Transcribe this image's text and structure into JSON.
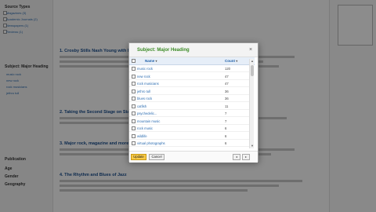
{
  "modal": {
    "title": "Subject: Major Heading",
    "close_icon": "×",
    "columns": {
      "name": "Name",
      "count": "Count"
    },
    "rows": [
      {
        "name": "music rock",
        "count": "120"
      },
      {
        "name": "new rock",
        "count": "47"
      },
      {
        "name": "rock musicians",
        "count": "47"
      },
      {
        "name": "jethro tull",
        "count": "36"
      },
      {
        "name": "blues rock",
        "count": "36"
      },
      {
        "name": "catfish",
        "count": "11"
      },
      {
        "name": "psychedelic...",
        "count": "7"
      },
      {
        "name": "mountain music",
        "count": "7"
      },
      {
        "name": "rock music",
        "count": "6"
      },
      {
        "name": "wildlife",
        "count": "6"
      },
      {
        "name": "virtual photographs",
        "count": "6"
      }
    ],
    "buttons": {
      "update": "Update",
      "cancel": "Cancel"
    },
    "pager": {
      "prev": "◂",
      "next": "▸"
    }
  },
  "background": {
    "sidebar": {
      "heading_1": "Source Types",
      "items_1": [
        "Magazines (3)",
        "Academic Journals (2)",
        "Newspapers (1)",
        "Reviews (1)"
      ],
      "heading_2": "Subject: Major Heading",
      "items_2": [
        "music rock",
        "new rock",
        "rock musicians",
        "jethro tull"
      ],
      "heading_3": "Publication",
      "heading_4": "Age",
      "heading_5": "Gender",
      "heading_6": "Geography"
    },
    "results": [
      "1. Crosby Stills Nash Young with Neil Young",
      "2. Taking the Second Stage on Stage",
      "3. Major rock, magazine and more",
      "4. The Rhythm and Blues of Jazz"
    ]
  }
}
